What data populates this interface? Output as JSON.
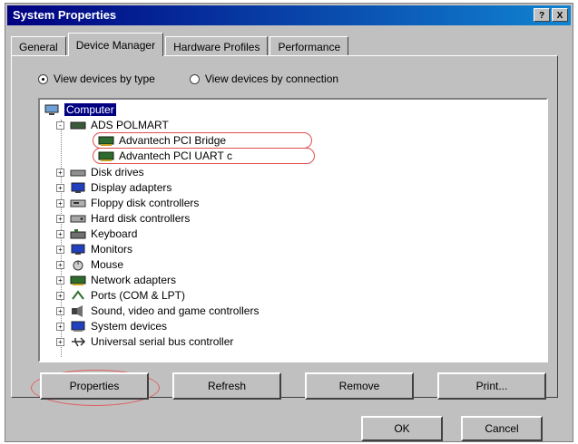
{
  "window": {
    "title": "System Properties",
    "help_btn": "?",
    "close_btn": "X"
  },
  "tabs": [
    {
      "label": "General"
    },
    {
      "label": "Device Manager"
    },
    {
      "label": "Hardware Profiles"
    },
    {
      "label": "Performance"
    }
  ],
  "view": {
    "by_type": "View devices by type",
    "by_connection": "View devices by connection",
    "selected": "by_type"
  },
  "tree": [
    {
      "label": "Computer",
      "icon": "computer-icon",
      "selected": true
    },
    {
      "label": "ADS POLMART",
      "icon": "device-icon",
      "expander": "-"
    },
    {
      "label": "Advantech PCI Bridge",
      "icon": "card-icon",
      "highlight": true
    },
    {
      "label": "Advantech PCI UART c",
      "icon": "card-icon",
      "highlight": true
    },
    {
      "label": "Disk drives",
      "icon": "disk-icon",
      "expander": "+"
    },
    {
      "label": "Display adapters",
      "icon": "monitor-icon",
      "expander": "+"
    },
    {
      "label": "Floppy disk controllers",
      "icon": "floppy-icon",
      "expander": "+"
    },
    {
      "label": "Hard disk controllers",
      "icon": "harddisk-icon",
      "expander": "+"
    },
    {
      "label": "Keyboard",
      "icon": "keyboard-icon",
      "expander": "+"
    },
    {
      "label": "Monitors",
      "icon": "monitor-icon",
      "expander": "+"
    },
    {
      "label": "Mouse",
      "icon": "mouse-icon",
      "expander": "+"
    },
    {
      "label": "Network adapters",
      "icon": "network-icon",
      "expander": "+"
    },
    {
      "label": "Ports (COM & LPT)",
      "icon": "port-icon",
      "expander": "+"
    },
    {
      "label": "Sound, video and game controllers",
      "icon": "sound-icon",
      "expander": "+"
    },
    {
      "label": "System devices",
      "icon": "system-icon",
      "expander": "+"
    },
    {
      "label": "Universal serial bus controller",
      "icon": "usb-icon",
      "expander": "+"
    }
  ],
  "buttons": {
    "properties": "Properties",
    "refresh": "Refresh",
    "remove": "Remove",
    "print": "Print...",
    "ok": "OK",
    "cancel": "Cancel"
  }
}
